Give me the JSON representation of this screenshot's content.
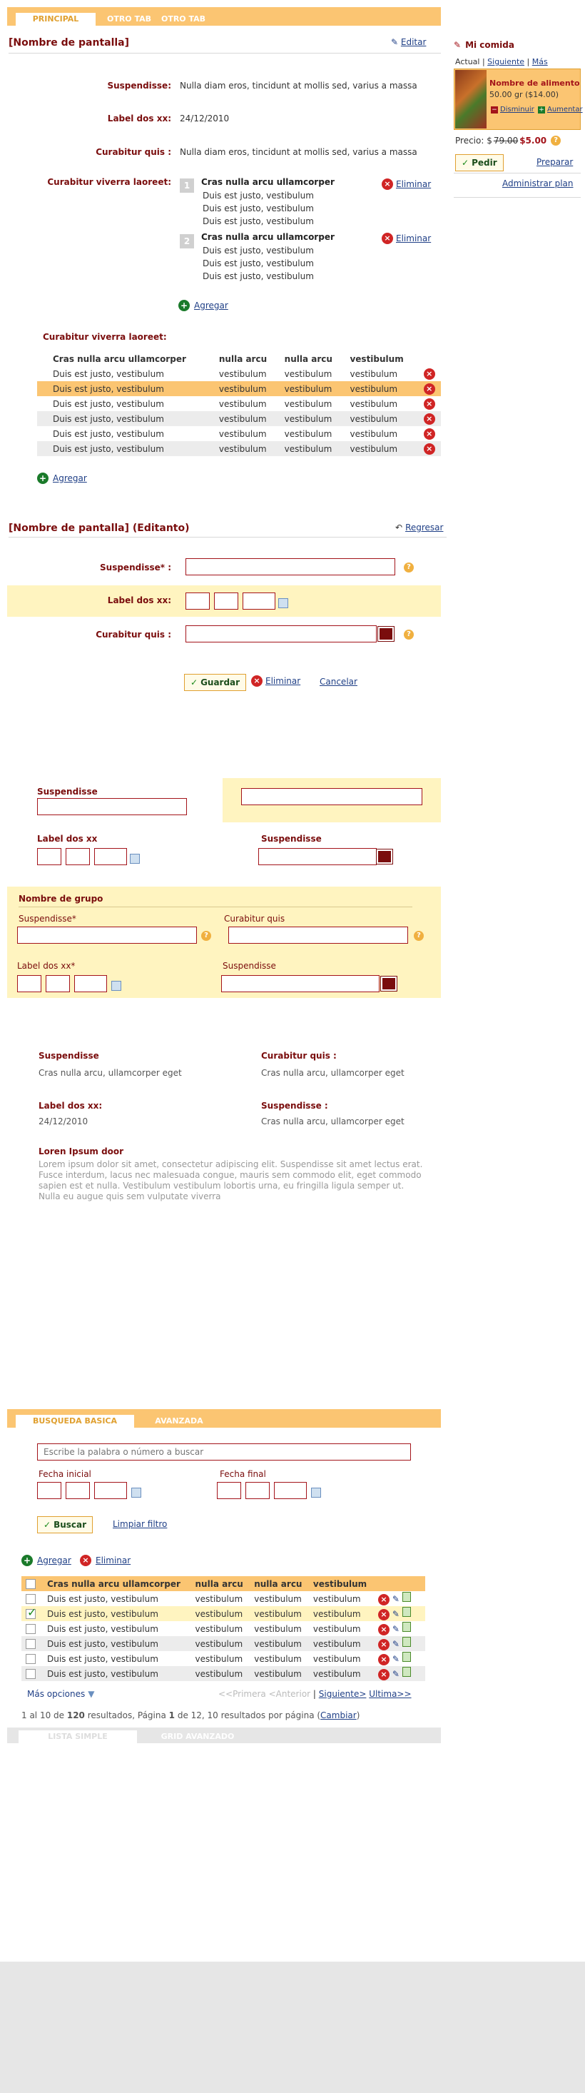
{
  "tabs": {
    "principal": "PRINCIPAL",
    "otro1": "OTRO TAB",
    "otro2": "OTRO TAB"
  },
  "view": {
    "title": "[Nombre de pantalla]",
    "edit_link": "Editar",
    "rows": [
      {
        "label": "Suspendisse:",
        "value": "Nulla diam eros, tincidunt at mollis sed, varius a massa"
      },
      {
        "label": "Label dos xx:",
        "value": "24/12/2010"
      },
      {
        "label": "Curabitur quis :",
        "value": "Nulla diam eros, tincidunt at mollis sed, varius a massa"
      }
    ],
    "list_label": "Curabitur viverra laoreet:",
    "list": [
      {
        "num": "1",
        "title": "Cras nulla arcu ullamcorper",
        "lines": [
          "Duis est justo, vestibulum",
          "Duis est justo, vestibulum",
          "Duis est justo, vestibulum"
        ],
        "delete": "Eliminar"
      },
      {
        "num": "2",
        "title": "Cras nulla arcu ullamcorper",
        "lines": [
          "Duis est justo, vestibulum",
          "Duis est justo, vestibulum",
          "Duis est justo, vestibulum"
        ],
        "delete": "Eliminar"
      }
    ],
    "add_link": "Agregar",
    "table_label": "Curabitur viverra laoreet:",
    "table_headers": [
      "Cras nulla arcu ullamcorper",
      "nulla arcu",
      "nulla arcu",
      "vestibulum"
    ],
    "table_rows": [
      [
        "Duis est justo, vestibulum",
        "vestibulum",
        "vestibulum",
        "vestibulum"
      ],
      [
        "Duis est justo, vestibulum",
        "vestibulum",
        "vestibulum",
        "vestibulum"
      ],
      [
        "Duis est justo, vestibulum",
        "vestibulum",
        "vestibulum",
        "vestibulum"
      ],
      [
        "Duis est justo, vestibulum",
        "vestibulum",
        "vestibulum",
        "vestibulum"
      ],
      [
        "Duis est justo, vestibulum",
        "vestibulum",
        "vestibulum",
        "vestibulum"
      ],
      [
        "Duis est justo, vestibulum",
        "vestibulum",
        "vestibulum",
        "vestibulum"
      ]
    ],
    "table_add": "Agregar"
  },
  "sidebar": {
    "title": "Mi comida",
    "nav_actual": "Actual",
    "nav_next": "Siguiente",
    "nav_more": "Más",
    "food_name": "Nombre de alimento",
    "food_price": "50.00 gr ($14.00)",
    "decrease": "Disminuir",
    "increase": "Aumentar",
    "price_label": "Precio: $",
    "price_old": "79.00",
    "price_new": "$5.00",
    "order_btn": "Pedir",
    "prepare_link": "Preparar",
    "admin_link": "Administrar plan"
  },
  "edit": {
    "title": "[Nombre de pantalla] (Editanto)",
    "back_link": "Regresar",
    "labels": [
      "Suspendisse* :",
      "Label dos xx:",
      "Curabitur quis :"
    ],
    "save": "Guardar",
    "delete": "Eliminar",
    "cancel": "Cancelar"
  },
  "form2": {
    "suspendisse": "Suspendisse",
    "label_dos": "Label dos xx",
    "suspendisse2": "Suspendisse",
    "group_title": "Nombre de grupo",
    "g_suspendisse": "Suspendisse*",
    "g_curabitur": "Curabitur quis",
    "g_label_dos": "Label dos xx*",
    "g_suspendisse2": "Suspendisse"
  },
  "detail": {
    "items": [
      {
        "label": "Suspendisse",
        "value": "Cras nulla arcu, ullamcorper eget"
      },
      {
        "label": "Curabitur quis :",
        "value": "Cras nulla arcu, ullamcorper eget"
      },
      {
        "label": "Label dos xx:",
        "value": "24/12/2010"
      },
      {
        "label": "Suspendisse :",
        "value": "Cras nulla arcu, ullamcorper eget"
      }
    ],
    "lorem_title": "Loren Ipsum door",
    "lorem_text": "Lorem ipsum dolor sit amet, consectetur adipiscing elit. Suspendisse sit amet lectus erat. Fusce interdum, lacus nec malesuada congue, mauris sem commodo elit, eget commodo sapien est et nulla. Vestibulum vestibulum lobortis urna, eu fringilla ligula semper ut. Nulla eu augue quis sem vulputate viverra"
  },
  "search": {
    "tab_basic": "BUSQUEDA BASICA",
    "tab_advanced": "AVANZADA",
    "placeholder": "Escribe la palabra o número a buscar",
    "start_label": "Fecha inicial",
    "end_label": "Fecha final",
    "search_btn": "Buscar",
    "clear_link": "Limpiar filtro"
  },
  "results": {
    "add": "Agregar",
    "delete": "Eliminar",
    "headers": [
      "Cras nulla arcu ullamcorper",
      "nulla arcu",
      "nulla arcu",
      "vestibulum"
    ],
    "rows": [
      {
        "checked": false,
        "cells": [
          "Duis est justo, vestibulum",
          "vestibulum",
          "vestibulum",
          "vestibulum"
        ]
      },
      {
        "checked": true,
        "cells": [
          "Duis est justo, vestibulum",
          "vestibulum",
          "vestibulum",
          "vestibulum"
        ]
      },
      {
        "checked": false,
        "cells": [
          "Duis est justo, vestibulum",
          "vestibulum",
          "vestibulum",
          "vestibulum"
        ]
      },
      {
        "checked": false,
        "cells": [
          "Duis est justo, vestibulum",
          "vestibulum",
          "vestibulum",
          "vestibulum"
        ]
      },
      {
        "checked": false,
        "cells": [
          "Duis est justo, vestibulum",
          "vestibulum",
          "vestibulum",
          "vestibulum"
        ]
      },
      {
        "checked": false,
        "cells": [
          "Duis est justo, vestibulum",
          "vestibulum",
          "vestibulum",
          "vestibulum"
        ]
      }
    ],
    "more_options": "Más opciones",
    "first": "<<Primera",
    "prev": "<Anterior",
    "next": "Siguiente>",
    "last": "Ultima>>",
    "summary_a": "1 al 10 de ",
    "summary_total": "120",
    "summary_b": " resultados, Página ",
    "summary_page": "1",
    "summary_c": " de 12, 10 resultados por página (",
    "change": "Cambiar",
    "summary_d": ")",
    "bottom_tab1": "LISTA SIMPLE",
    "bottom_tab2": "GRID AVANZADO"
  }
}
